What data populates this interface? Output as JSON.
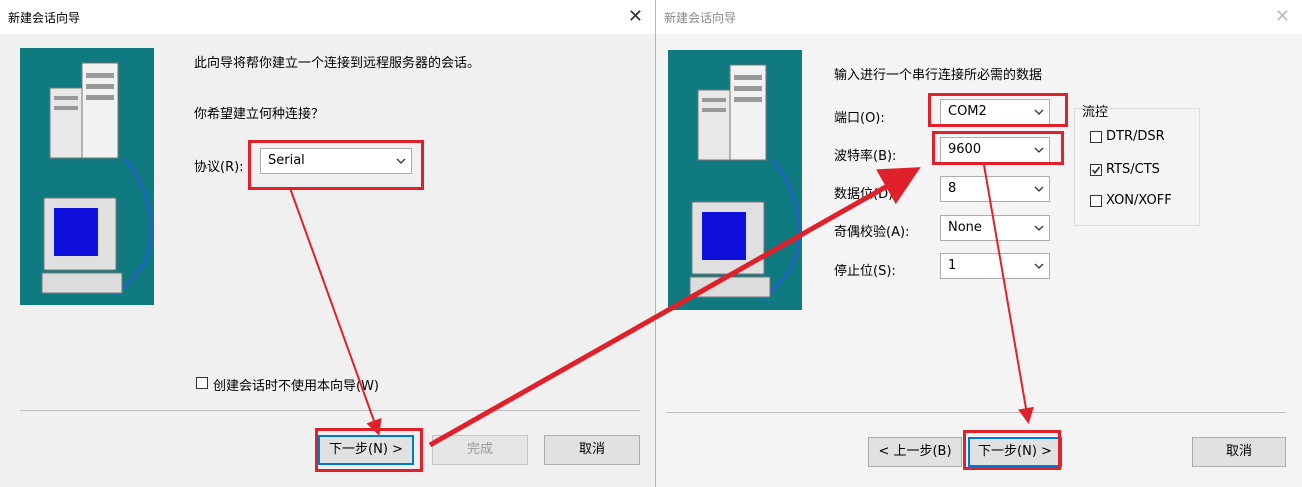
{
  "left_dialog": {
    "title": "新建会话向导",
    "intro": "此向导将帮你建立一个连接到远程服务器的会话。",
    "question": "你希望建立何种连接？",
    "protocol_label": "协议(R):",
    "protocol_value": "Serial",
    "no_wizard_label": "创建会话时不使用本向导(W)",
    "buttons": {
      "next": "下一步(N) >",
      "finish": "完成",
      "cancel": "取消"
    }
  },
  "right_dialog": {
    "title": "新建会话向导",
    "heading": "输入进行一个串行连接所必需的数据",
    "fields": {
      "port": {
        "label": "端口(O):",
        "value": "COM2"
      },
      "baud": {
        "label": "波特率(B):",
        "value": "9600"
      },
      "databits": {
        "label": "数据位(D):",
        "value": "8"
      },
      "parity": {
        "label": "奇偶校验(A):",
        "value": "None"
      },
      "stopbits": {
        "label": "停止位(S):",
        "value": "1"
      }
    },
    "flow_control": {
      "label": "流控",
      "dtr": {
        "label": "DTR/DSR",
        "checked": false
      },
      "rts": {
        "label": "RTS/CTS",
        "checked": true
      },
      "xon": {
        "label": "XON/XOFF",
        "checked": false
      }
    },
    "buttons": {
      "back": "< 上一步(B)",
      "next": "下一步(N) >",
      "cancel": "取消"
    }
  },
  "colors": {
    "annotation": "#e0202a",
    "art_background": "#0f7a80",
    "focus_border": "#0078d7"
  }
}
